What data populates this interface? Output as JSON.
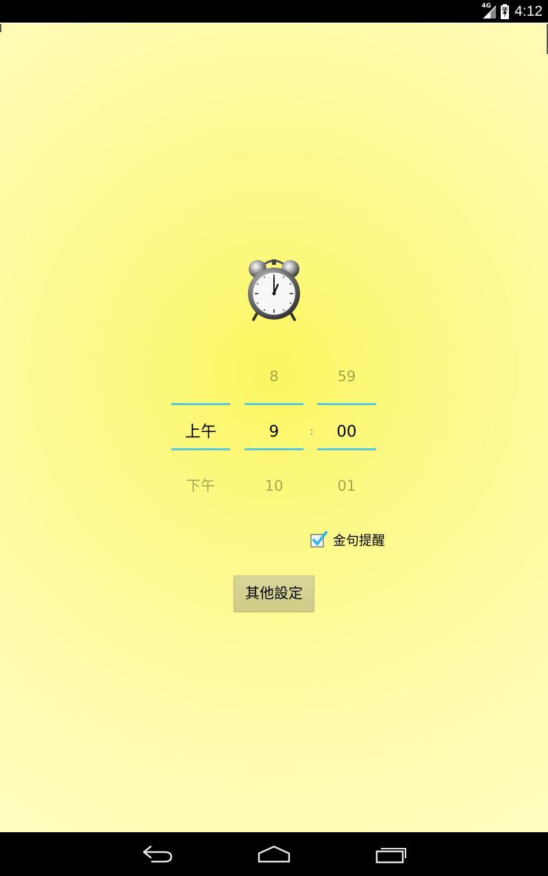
{
  "status_bar": {
    "network_label": "4G",
    "time": "4:12"
  },
  "time_picker": {
    "ampm": {
      "prev": "",
      "current": "上午",
      "next": "下午"
    },
    "hour": {
      "prev": "8",
      "current": "9",
      "next": "10"
    },
    "separator": ":",
    "minute": {
      "prev": "59",
      "current": "00",
      "next": "01"
    }
  },
  "quote_reminder": {
    "label": "金句提醒",
    "checked": true
  },
  "other_settings_button": {
    "label": "其他設定"
  },
  "colors": {
    "accent_divider": "#55c6df",
    "checkbox_check": "#33b5e5",
    "background_center": "#fbf75f",
    "background_edge": "#fffcc0",
    "button_bg": "#d8d69a"
  },
  "icons": {
    "alarm": "alarm-clock-icon",
    "back": "back-icon",
    "home": "home-icon",
    "recents": "recents-icon"
  }
}
